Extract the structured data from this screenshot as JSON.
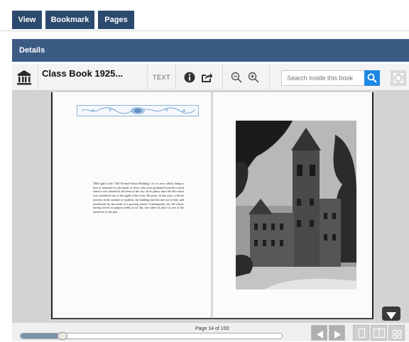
{
  "tabs": [
    {
      "label": "View"
    },
    {
      "label": "Bookmark"
    },
    {
      "label": "Pages"
    }
  ],
  "details": {
    "label": "Details"
  },
  "toolbar": {
    "title": "Class Book 1925...",
    "text_label": "TEXT",
    "search_placeholder": "Search inside this book"
  },
  "page": {
    "paragraph": "THE sight of the \"Old Normal School Building\" as it is now called, brings a host of memories to the minds of those who were graduated from the school when it was situated in the heart of the city. In its palmy days the old school was considered one of the sights of the town. However, in late years, with the increase in the number of students, the building had become out of date, and insufficient for the needs of a growing school. Consequently, the old school, having served its purpose nobly in its day, now takes its place as one of the memories of the past."
  },
  "footer": {
    "page_indicator": "Page 14 of 100",
    "progress": 0.14
  },
  "colors": {
    "tab_bg": "#2c4a6e",
    "details_bg": "#3b5b84",
    "search_button": "#1e88e5",
    "viewer_bg": "#d3d3d3"
  },
  "icons": [
    "library-icon",
    "info-icon",
    "share-icon",
    "zoom-out-icon",
    "zoom-in-icon",
    "search-icon",
    "fullscreen-icon",
    "chevron-down-icon",
    "previous-page-icon",
    "next-page-icon",
    "one-page-view-icon",
    "two-page-view-icon",
    "thumbnail-view-icon"
  ]
}
